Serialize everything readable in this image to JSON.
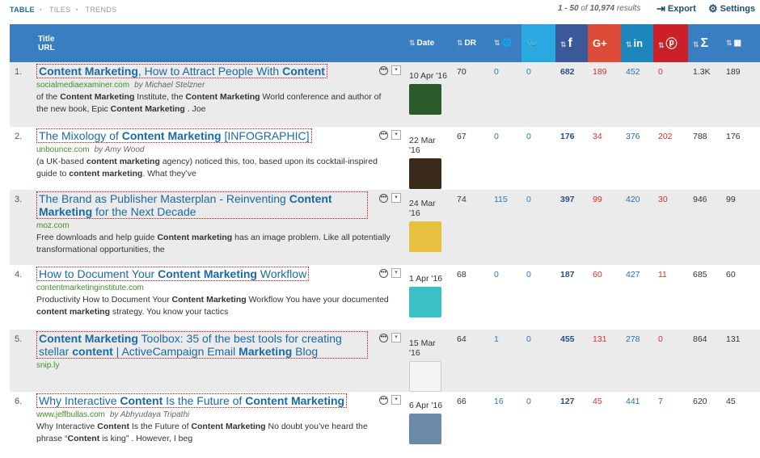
{
  "view_tabs": [
    "TABLE",
    "TILES",
    "TRENDS"
  ],
  "results": {
    "range": "1 - 50",
    "of": "of",
    "total": "10,974",
    "suffix": "results"
  },
  "toolbar": {
    "export": "Export",
    "settings": "Settings"
  },
  "columns": {
    "title": "Title",
    "url": "URL",
    "date": "Date",
    "dr": "DR",
    "g": "G+",
    "sum": "Σ"
  },
  "rows": [
    {
      "n": "1.",
      "title": "Content Marketing, How to Attract People With Content",
      "domain": "socialmediaexaminer.com",
      "author": "by Michael Stelzner",
      "snippet": "of the Content Marketing Institute, the Content Marketing World conference and author of the new book,  Epic Content Marketing . Joe",
      "date": "10 Apr '16",
      "dr": "70",
      "c1": "0",
      "tw": "0",
      "fb": "682",
      "gp": "189",
      "li": "452",
      "pi": "0",
      "sum": "1.3K",
      "last": "189",
      "thumb": "#2a5a2a"
    },
    {
      "n": "2.",
      "title": "The Mixology of Content Marketing [INFOGRAPHIC]",
      "domain": "unbounce.com",
      "author": "by Amy Wood",
      "snippet": "(a UK-based content marketing agency) noticed this, too, based upon its cocktail-inspired guide to content marketing. What they’ve",
      "date": "22 Mar '16",
      "dr": "67",
      "c1": "0",
      "tw": "0",
      "fb": "176",
      "gp": "34",
      "li": "376",
      "pi": "202",
      "sum": "788",
      "last": "176",
      "thumb": "#3a2a1a"
    },
    {
      "n": "3.",
      "title": "The Brand as Publisher Masterplan - Reinventing Content Marketing for the Next Decade",
      "domain": "moz.com",
      "author": "",
      "snippet": "Free downloads and help guide Content marketing has an image problem. Like all potentially transformational opportunities, the",
      "date": "24 Mar '16",
      "dr": "74",
      "c1": "115",
      "tw": "0",
      "fb": "397",
      "gp": "99",
      "li": "420",
      "pi": "30",
      "sum": "946",
      "last": "99",
      "thumb": "#e8c040"
    },
    {
      "n": "4.",
      "title": "How to Document Your Content Marketing Workflow",
      "domain": "contentmarketinginstitute.com",
      "author": "",
      "snippet": "Productivity How to Document Your Content Marketing Workflow You have your documented content marketing strategy. You know your tactics",
      "date": "1 Apr '16",
      "dr": "68",
      "c1": "0",
      "tw": "0",
      "fb": "187",
      "gp": "60",
      "li": "427",
      "pi": "11",
      "sum": "685",
      "last": "60",
      "thumb": "#3cc0c8"
    },
    {
      "n": "5.",
      "title": "Content Marketing Toolbox: 35 of the best tools for creating stellar content | ActiveCampaign Email Marketing Blog",
      "domain": "snip.ly",
      "author": "",
      "snippet": "",
      "date": "15 Mar '16",
      "dr": "64",
      "c1": "1",
      "tw": "0",
      "fb": "455",
      "gp": "131",
      "li": "278",
      "pi": "0",
      "sum": "864",
      "last": "131",
      "thumb": "#f4f4f4"
    },
    {
      "n": "6.",
      "title": "Why Interactive Content Is the Future of Content Marketing",
      "domain": "www.jeffbullas.com",
      "author": "by Abhyudaya Tripathi",
      "snippet": "Why Interactive Content Is the Future of Content Marketing No doubt you’ve heard the phrase “Content is king” . However, I beg",
      "date": "6 Apr '16",
      "dr": "66",
      "c1": "16",
      "tw": "0",
      "fb": "127",
      "gp": "45",
      "li": "441",
      "pi": "7",
      "sum": "620",
      "last": "45",
      "thumb": "#6a8aa8"
    }
  ]
}
